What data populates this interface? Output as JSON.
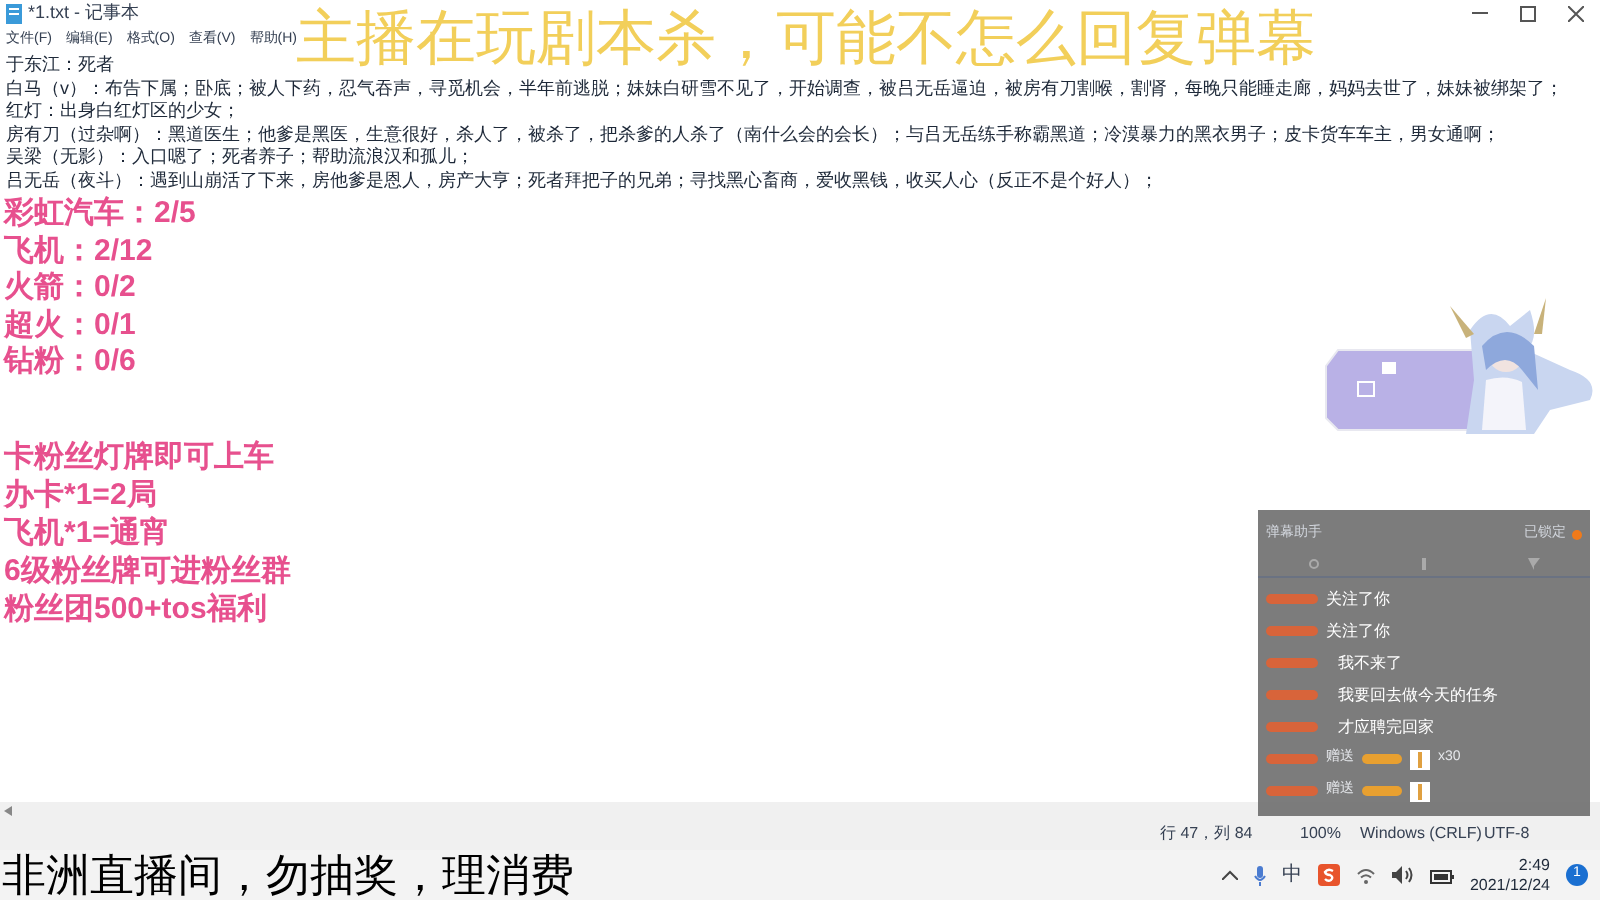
{
  "window": {
    "title": "*1.txt - 记事本"
  },
  "menu": [
    "文件(F)",
    "编辑(E)",
    "格式(O)",
    "查看(V)",
    "帮助(H)"
  ],
  "document_lines": [
    "于东江：死者",
    "白马（v）：布告下属；卧底；被人下药，忍气吞声，寻觅机会，半年前逃脱；妹妹白研雪不见了，开始调查，被吕无岳逼迫，被房有刀割喉，割肾，每晚只能睡走廊，妈妈去世了，妹妹被绑架了；",
    "红灯：出身白红灯区的少女；",
    "房有刀（过杂啊）：黑道医生；他爹是黑医，生意很好，杀人了，被杀了，把杀爹的人杀了（南什么会的会长）；与吕无岳练手称霸黑道；冷漠暴力的黑衣男子；皮卡货车车主，男女通啊；",
    "吴梁（无影）：入口嗯了；死者养子；帮助流浪汉和孤儿；",
    "吕无岳（夜斗）：遇到山崩活了下来，房他爹是恩人，房产大亨；死者拜把子的兄弟；寻找黑心畜商，爱收黑钱，收买人心（反正不是个好人）；"
  ],
  "status_bar": [
    "行 47，列 84",
    "100%",
    "Windows (CRLF)",
    "UTF-8"
  ],
  "stream_banner": "主播在玩剧本杀，可能不怎么回复弹幕",
  "gift_goals": [
    "彩虹汽车：2/5",
    "飞机：2/12",
    "火箭：0/2",
    "超火：0/1",
    "钻粉：0/6"
  ],
  "fan_notes": [
    "卡粉丝灯牌即可上车",
    "办卡*1=2局",
    "飞机*1=通宵",
    "6级粉丝牌可进粉丝群",
    "粉丝团500+tos福利"
  ],
  "character_card": {
    "kind": "picture"
  },
  "chat_panel": {
    "title": "弹幕助手",
    "lock_label": "已锁定",
    "messages": [
      {
        "kind": "follow",
        "text": "关注了你"
      },
      {
        "kind": "follow",
        "text": "关注了你"
      },
      {
        "kind": "chat",
        "text": "我不来了"
      },
      {
        "kind": "chat",
        "text": "我要回去做今天的任务"
      },
      {
        "kind": "chat",
        "text": "才应聘完回家"
      },
      {
        "kind": "gift",
        "text": "赠送",
        "count": "x30"
      },
      {
        "kind": "gift",
        "text": "赠送"
      }
    ]
  },
  "caption": "非洲直播间，勿抽奖，理消费",
  "tray": {
    "ime": "中",
    "time": "2:49",
    "date": "2021/12/24",
    "notifications": "1"
  }
}
